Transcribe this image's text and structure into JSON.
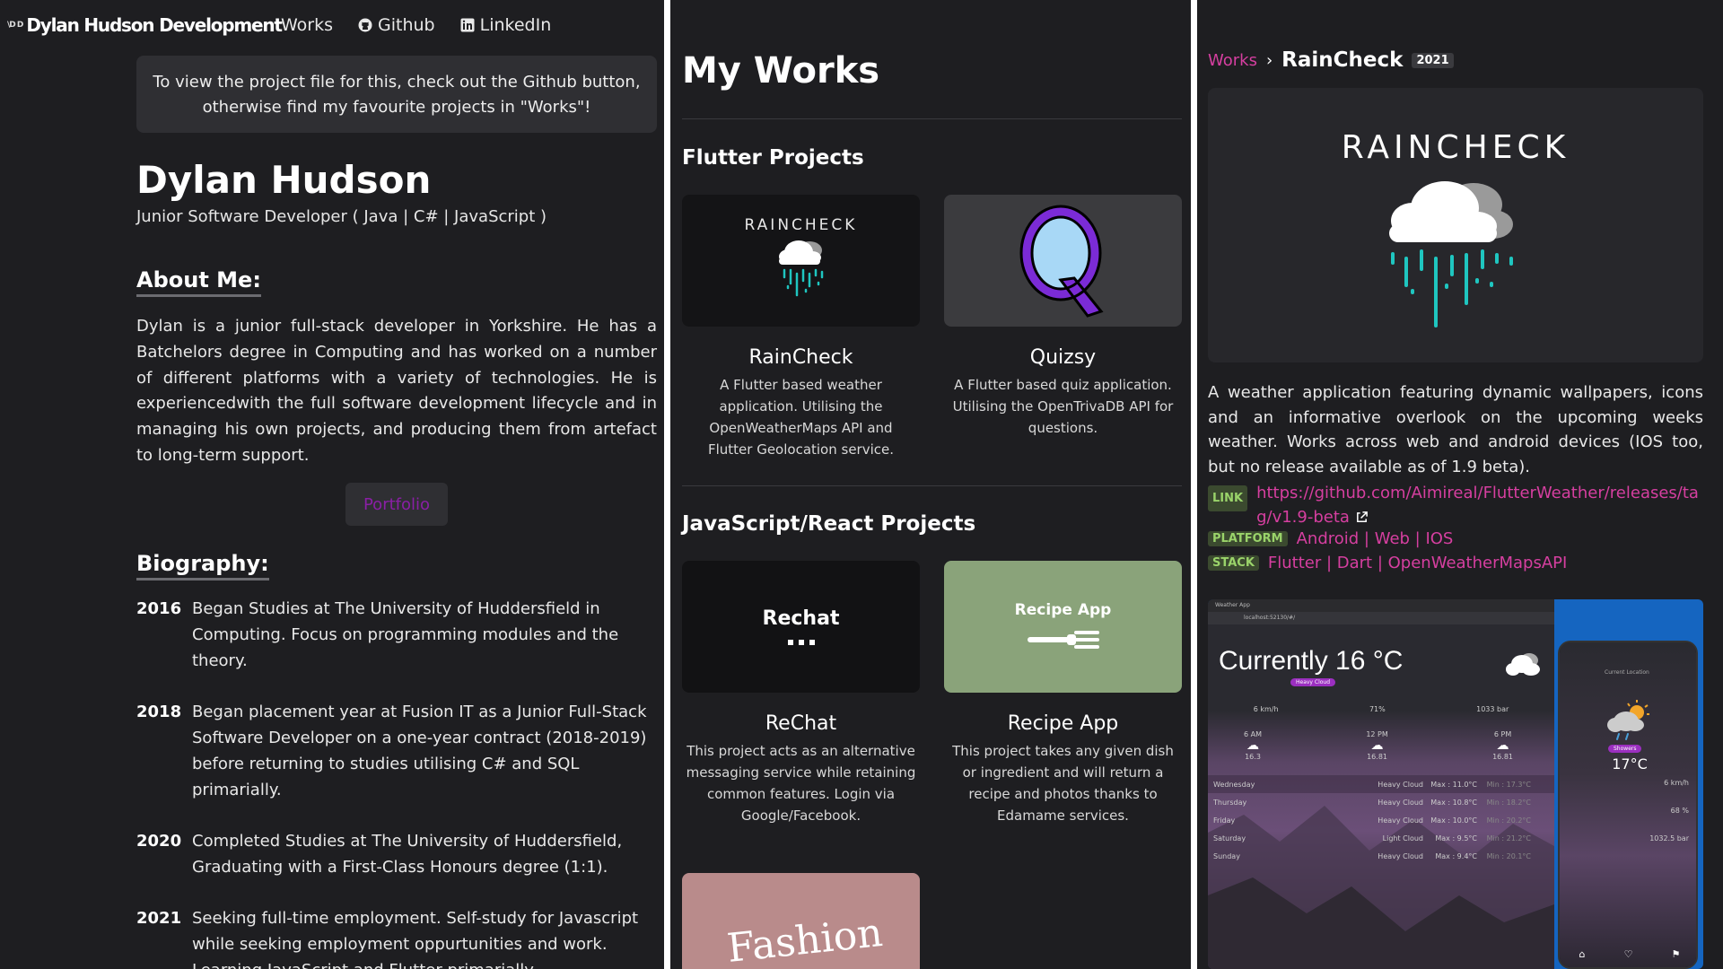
{
  "panel1": {
    "nav": {
      "brand_logo": "\\D D",
      "brand_name": "Dylan Hudson Development",
      "links": [
        {
          "label": "Works",
          "icon": ""
        },
        {
          "label": "Github",
          "icon": "github-icon"
        },
        {
          "label": "LinkedIn",
          "icon": "linkedin-icon"
        }
      ]
    },
    "notice": "To view the project file for this, check out the Github button, otherwise find my favourite projects in \"Works\"!",
    "name": "Dylan Hudson",
    "subtitle": "Junior Software Developer ( Java | C# | JavaScript )",
    "about_title": "About Me:",
    "about_text": "Dylan is a junior full-stack developer in Yorkshire. He has a Batchelors degree in Computing and has worked on a number of different platforms with a variety of technologies. He is experiencedwith the full software development lifecycle and in managing his own projects, and producing them from artefact to long-term support.",
    "portfolio_label": "Portfolio",
    "bio_title": "Biography:",
    "bio": [
      {
        "year": "2016",
        "text": "Began Studies at The University of Huddersfield in Computing. Focus on programming modules and the theory."
      },
      {
        "year": "2018",
        "text": "Began placement year at Fusion IT as a Junior Full-Stack Software Developer on a one-year contract (2018-2019) before returning to studies utilising C# and SQL primarially."
      },
      {
        "year": "2020",
        "text": "Completed Studies at The University of Huddersfield, Graduating with a First-Class Honours degree (1:1)."
      },
      {
        "year": "2021",
        "text": "Seeking full-time employment. Self-study for Javascript while seeking employment oppurtunities and work. Learning JavaScript and Flutter primarially."
      }
    ]
  },
  "panel2": {
    "title": "My Works",
    "flutter_title": "Flutter Projects",
    "js_title": "JavaScript/React Projects",
    "cards": [
      {
        "title": "RainCheck",
        "thumb_text": "RAINCHECK",
        "desc": "A Flutter based weather application. Utilising the OpenWeatherMaps API and Flutter Geolocation service."
      },
      {
        "title": "Quizsy",
        "thumb_text": "Q",
        "desc": "A Flutter based quiz application. Utilising the OpenTrivaDB API for questions."
      },
      {
        "title": "ReChat",
        "thumb_text": "Rechat",
        "desc": "This project acts as an alternative messaging service while retaining common features. Login via Google/Facebook."
      },
      {
        "title": "Recipe App",
        "thumb_text": "Recipe App",
        "desc": "This project takes any given dish or ingredient and will return a recipe and photos thanks to Edamame services."
      },
      {
        "title": "",
        "thumb_text": "Fashion",
        "desc": ""
      }
    ]
  },
  "panel3": {
    "crumb_link": "Works",
    "crumb_sep": "›",
    "crumb_current": "RainCheck",
    "crumb_year": "2021",
    "banner_text": "RAINCHECK",
    "description": "A weather application featuring dynamic wallpapers, icons and an informative overlook on the upcoming weeks weather. Works across web and android devices (IOS too, but no release available as of 1.9 beta).",
    "link_badge": "LINK",
    "link_value": "https://github.com/Aimireal/FlutterWeather/releases/tag/v1.9-beta",
    "platform_badge": "PLATFORM",
    "platform_value": "Android | Web | IOS",
    "stack_badge": "STACK",
    "stack_value": "Flutter | Dart | OpenWeatherMapsAPI",
    "screenshot": {
      "tab": "Weather App",
      "url": "localhost:52130/#/",
      "currently": "Currently 16 °C",
      "pill": "Heavy Cloud",
      "stats": [
        "6 km/h",
        "71%",
        "1033 bar"
      ],
      "hours": [
        {
          "t": "6 AM",
          "v": "16.3"
        },
        {
          "t": "12 PM",
          "v": "16.81"
        },
        {
          "t": "6 PM",
          "v": "16.81"
        }
      ],
      "days": [
        {
          "d": "Wednesday",
          "c": "Heavy Cloud",
          "mx": "Max : 11.0°C",
          "mn": "Min : 17.3°C"
        },
        {
          "d": "Thursday",
          "c": "Heavy Cloud",
          "mx": "Max : 10.8°C",
          "mn": "Min : 18.2°C"
        },
        {
          "d": "Friday",
          "c": "Heavy Cloud",
          "mx": "Max : 10.0°C",
          "mn": "Min : 20.2°C"
        },
        {
          "d": "Saturday",
          "c": "Light Cloud",
          "mx": "Max : 9.5°C",
          "mn": "Min : 21.2°C"
        },
        {
          "d": "Sunday",
          "c": "Heavy Cloud",
          "mx": "Max : 9.4°C",
          "mn": "Min : 20.1°C"
        }
      ],
      "phone": {
        "loc": "Current Location",
        "pill": "Showers",
        "temp": "17°C",
        "stats": [
          "6 km/h",
          "68 %",
          "1032.5 bar"
        ]
      }
    }
  }
}
